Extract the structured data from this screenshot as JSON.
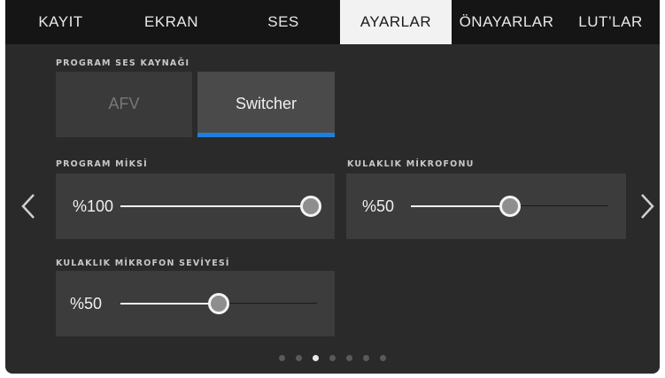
{
  "tabs": [
    {
      "label": "KAYIT",
      "active": false
    },
    {
      "label": "EKRAN",
      "active": false
    },
    {
      "label": "SES",
      "active": false
    },
    {
      "label": "AYARLAR",
      "active": true
    },
    {
      "label": "ÖNAYARLAR",
      "active": false
    },
    {
      "label": "LUT’LAR",
      "active": false
    }
  ],
  "program_source": {
    "label": "PROGRAM SES KAYNAĞI",
    "options": [
      "AFV",
      "Switcher"
    ],
    "selected": "Switcher"
  },
  "program_mix": {
    "label": "PROGRAM MİKSİ",
    "value_text": "%100",
    "level": 1.0
  },
  "headset_mic": {
    "label": "KULAKLIK MİKROFONU",
    "value_text": "%50",
    "level": 0.5
  },
  "headset_mic_level": {
    "label": "KULAKLIK MİKROFON SEVİYESİ",
    "value_text": "%50",
    "level": 0.5
  },
  "pagination": {
    "total": 7,
    "current": 3
  },
  "colors": {
    "accent": "#1e7fe0",
    "active_tab_bg": "#f2f2f2",
    "panel_bg": "#2a2a2a"
  },
  "icons": {
    "prev": "chevron-left-icon",
    "next": "chevron-right-icon"
  }
}
